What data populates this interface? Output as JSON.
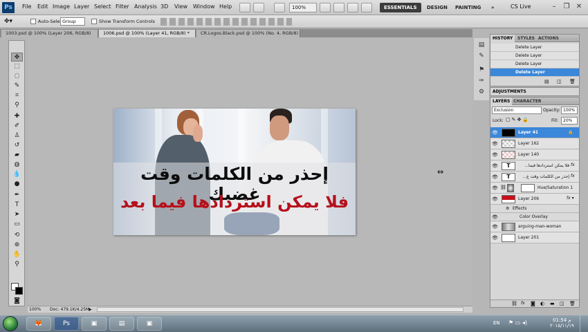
{
  "menubar": {
    "logo": "Ps",
    "items": [
      "File",
      "Edit",
      "Image",
      "Layer",
      "Select",
      "Filter",
      "Analysis",
      "3D",
      "View",
      "Window",
      "Help"
    ],
    "zoom": "100%",
    "workspaces": [
      "ESSENTIALS",
      "DESIGN",
      "PAINTING"
    ],
    "more": "»",
    "cs_live": "CS Live"
  },
  "options": {
    "auto_select_label": "Auto-Select:",
    "auto_select_value": "Group",
    "transform_label": "Show Transform Controls"
  },
  "tabs": [
    {
      "label": "1003.psd @ 100% (Layer 206, RGB/8)"
    },
    {
      "label": "1006.psd @ 100% (Layer 41, RGB/8) *"
    },
    {
      "label": "CR.Logos.Black.psd @ 100% (No. 4, RGB/8)"
    }
  ],
  "image": {
    "line1": "إحذر من الكلمات وقت غضبك",
    "line2": "فلا يمكن استردادها فيما بعد"
  },
  "status": {
    "zoom": "100%",
    "doc": "Doc: 479.1K/4.25M"
  },
  "history": {
    "tabs": [
      "HISTORY",
      "STYLES",
      "ACTIONS"
    ],
    "rows": [
      "Delete Layer",
      "Delete Layer",
      "Delete Layer",
      "Delete Layer"
    ]
  },
  "adjustments": {
    "title": "ADJUSTMENTS"
  },
  "layers": {
    "tabs": [
      "LAYERS",
      "CHARACTER"
    ],
    "blend_mode": "Exclusion",
    "opacity_label": "Opacity:",
    "opacity": "100%",
    "lock_label": "Lock:",
    "fill_label": "Fill:",
    "fill": "20%",
    "rows": [
      {
        "name": "Layer 41",
        "type": "pixel"
      },
      {
        "name": "Layer 162",
        "type": "pixel"
      },
      {
        "name": "Layer 140",
        "type": "pixel"
      },
      {
        "name": "فلا يمكن استردادها فيما...",
        "type": "text"
      },
      {
        "name": "إحذر من الكلمات وقت غ...",
        "type": "text"
      },
      {
        "name": "Hue/Saturation 1",
        "type": "adjustment"
      },
      {
        "name": "Layer 206",
        "type": "pixel"
      },
      {
        "name": "Effects",
        "type": "effects"
      },
      {
        "name": "Color Overlay",
        "type": "effect"
      },
      {
        "name": "arguing-man-woman",
        "type": "pixel"
      },
      {
        "name": "Layer 201",
        "type": "pixel"
      }
    ]
  },
  "taskbar": {
    "lang": "EN",
    "time": "01:54 م",
    "date": "٢٠١٥/١١/١٩"
  }
}
